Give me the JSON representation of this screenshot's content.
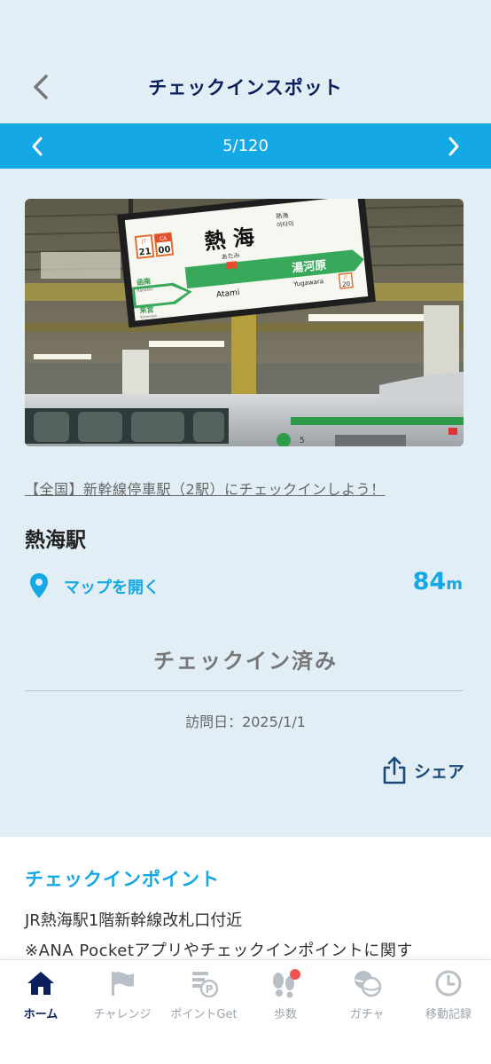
{
  "header": {
    "title": "チェックインスポット"
  },
  "pager": {
    "current": "5/120"
  },
  "challenge": {
    "link_text": "【全国】新幹線停車駅（2駅）にチェックインしよう！"
  },
  "spot": {
    "name": "熱海駅",
    "map_label": "マップを開く",
    "distance_value": "84",
    "distance_unit": "m",
    "status": "チェックイン済み",
    "visit_date": "訪問日：2025/1/1",
    "share_label": "シェア"
  },
  "photo_sign": {
    "station_kanji": "熱 海",
    "station_kana": "あたみ",
    "station_romaji": "Atami",
    "code_left_top": "JT",
    "code_left_num": "21",
    "code_right_top": "CA",
    "code_right_num": "00",
    "next_station": "湯河原",
    "next_romaji": "Yugawara",
    "next_code_top": "JT",
    "next_code_num": "20",
    "prev_station_1": "函南",
    "prev_romaji_1": "Kannami",
    "prev_station_2": "来宮",
    "prev_romaji_2": "Kinomiya",
    "small_kanji": "熱海",
    "small_hangul": "아타미",
    "car_number": "5"
  },
  "checkin_point": {
    "title": "チェックインポイント",
    "line1": "JR熱海駅1階新幹線改札口付近",
    "line2": "※ANA Pocketアプリやチェックインポイントに関す"
  },
  "tabs": [
    {
      "label": "ホーム",
      "icon": "home-icon",
      "active": true
    },
    {
      "label": "チャレンジ",
      "icon": "flag-icon",
      "active": false
    },
    {
      "label": "ポイントGet",
      "icon": "points-icon",
      "active": false
    },
    {
      "label": "歩数",
      "icon": "footsteps-icon",
      "active": false
    },
    {
      "label": "ガチャ",
      "icon": "gacha-icon",
      "active": false
    },
    {
      "label": "移動記録",
      "icon": "clock-icon",
      "active": false
    }
  ],
  "colors": {
    "accent": "#14a8e5",
    "navy": "#0b1f5c",
    "background": "#e1eef6",
    "badge": "#ef5350"
  }
}
